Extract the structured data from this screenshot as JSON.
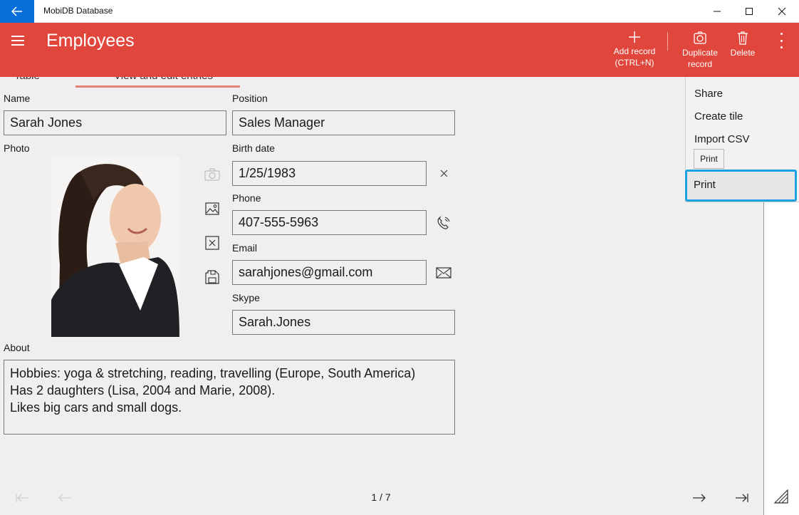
{
  "window": {
    "title": "MobiDB Database"
  },
  "header": {
    "title": "Employees",
    "add_label": "Add record",
    "add_shortcut": "(CTRL+N)",
    "duplicate_label_1": "Duplicate",
    "duplicate_label_2": "record",
    "delete_label": "Delete"
  },
  "tabs": {
    "table": "Table",
    "view": "View and edit entries"
  },
  "form": {
    "name_label": "Name",
    "name_value": "Sarah Jones",
    "position_label": "Position",
    "position_value": "Sales Manager",
    "photo_label": "Photo",
    "birth_label": "Birth date",
    "birth_value": "1/25/1983",
    "phone_label": "Phone",
    "phone_value": "407-555-5963",
    "email_label": "Email",
    "email_value": "sarahjones@gmail.com",
    "skype_label": "Skype",
    "skype_value": "Sarah.Jones",
    "about_label": "About",
    "about_lines": [
      "Hobbies: yoga & stretching, reading, travelling (Europe, South America)",
      "Has 2 daughters (Lisa, 2004 and Marie, 2008).",
      "Likes big cars and small dogs."
    ]
  },
  "menu": {
    "share": "Share",
    "create_tile": "Create tile",
    "import_csv": "Import CSV",
    "tooltip": "Print",
    "print": "Print"
  },
  "pager": {
    "text": "1 / 7"
  },
  "colors": {
    "accent_red": "#e0463b",
    "accent_blue": "#0a6fd8",
    "focus_ring": "#1ba1e2"
  }
}
